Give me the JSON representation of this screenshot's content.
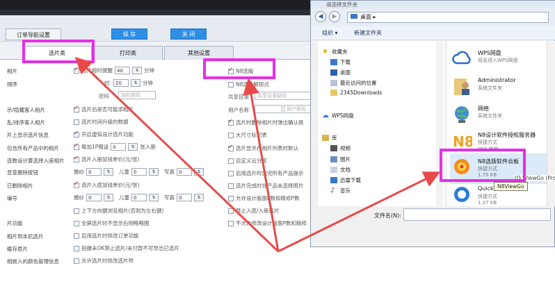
{
  "settings": {
    "title_left": "",
    "main_tab": "订单导航设置",
    "save_label": "保 存",
    "close_label": "关 闭",
    "tabs": [
      "选片类",
      "打印类",
      "其他设置"
    ],
    "left_labels": [
      "相片",
      "顺序",
      "示/隐藏客人相片",
      "乱/排序客人相片",
      "片上显示选片信息",
      "包含所有产品中的相片",
      "选数设计算选择入座相片",
      "显查删除按钮",
      "已删除相片",
      "编号",
      "",
      "片功能",
      "相片到本机选片",
      "缓存原片",
      "相嵌入的颜色管理信息"
    ],
    "opt_timer_label": "选片超时提醒",
    "opt_timer_value": "40",
    "opt_timer_unit": "分钟",
    "opt_row2_label": "时:",
    "opt_row2_value": "20",
    "opt_row2_unit": "分钟",
    "opt_pwd_label": "密码",
    "opt_pwd_placeholder": "加时密码",
    "opt_a": "选片后是否可能添相片",
    "opt_b": "选片时间升级的数据",
    "opt_c": "开启虚拟设计选片功能",
    "opt_d_label": "每加1P赠送",
    "opt_d_value": "0",
    "opt_d_unit": "张入册",
    "opt_e": "选片入册加钱单价(元/张)",
    "opt_f_label1": "婚纱",
    "opt_f_label2": "儿童",
    "opt_f_label3": "写真",
    "opt_f_value": "0",
    "opt_g": "选片入底加钱单价(元/张)",
    "opt_h": "上下方向键浏览相片(否则为左右键)",
    "opt_i": "全屏选片时不显示右侧略略图",
    "opt_j": "启用选片时修改订单功能",
    "opt_k": "拍摄未OK禁止选片/未付款不可导出已选片",
    "opt_l": "允许选片时修改选片师",
    "right_n8": "N8选版",
    "right_n8_sub": "N8选版解锁式",
    "right_share_label": "共享目录",
    "right_share_placeholder": "共享目录路径",
    "right_user_label": "用户名称",
    "right_user_placeholder": "用户密码",
    "right_opts": [
      "选片时删除相片时弹出确认框",
      "大尺寸标记表",
      "选片显示在相片列表时默认",
      "自定义云分享",
      "启用选片时出完所有产品提示",
      "选片完成时在产品未选择照片",
      "允许设计版面P数和精修P数",
      "禁止入底/入册选片",
      "不允许修改设计版面P数和精修"
    ]
  },
  "dialog": {
    "title": "请选择文件夹",
    "address": "桌面",
    "organize": "组织 ▾",
    "new_folder": "新建文件夹",
    "tree": {
      "favorites": "收藏夹",
      "downloads": "下载",
      "desktop": "桌面",
      "recent": "最近访问的位置",
      "folder2345": "2345Downloads",
      "wps_disk": "WPS网盘",
      "library": "库",
      "videos": "视频",
      "pictures": "图片",
      "documents": "文档",
      "thunder": "迅雷下载",
      "music": "音乐"
    },
    "files": [
      {
        "name": "WPS网盘",
        "type": "双击进入WPS网盘",
        "size": ""
      },
      {
        "name": "Administrator",
        "type": "系统文件夹",
        "size": ""
      },
      {
        "name": "网络",
        "type": "系统文件夹",
        "size": ""
      },
      {
        "name": "N8设计软件授权服务器",
        "type": "快捷方式",
        "size": "956 字节"
      },
      {
        "name": "N8选版软件云板",
        "type": "快捷方式",
        "size": "1.79 KB"
      },
      {
        "name": "QuickTime",
        "type": "快捷方式",
        "size": "1.37 KB"
      }
    ],
    "tooltip": "N8ViewGo",
    "tooltip_path": "(D:\\ViewGo (Pro",
    "filename_label": "文件名(N):",
    "filename_value": ""
  },
  "colors": {
    "highlight": "#e62ee6",
    "arrow": "#e84a4a",
    "button_blue": "#2e8fe6",
    "check_red": "#d21f1f"
  }
}
